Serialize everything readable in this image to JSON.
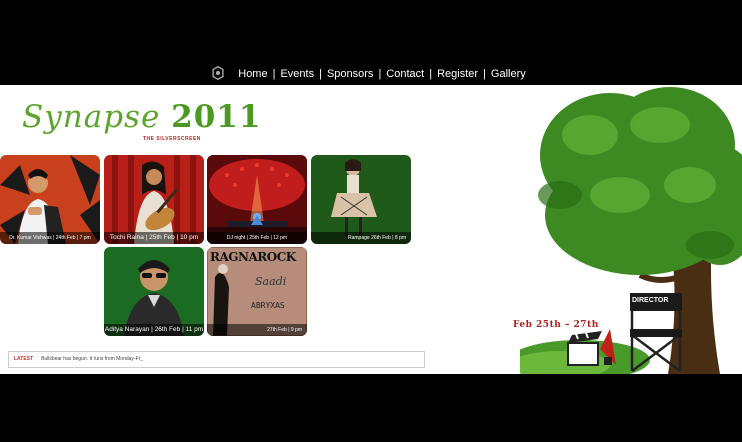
{
  "nav": {
    "items": [
      {
        "label": "Home"
      },
      {
        "label": "Events"
      },
      {
        "label": "Sponsors"
      },
      {
        "label": "Contact"
      },
      {
        "label": "Register"
      },
      {
        "label": "Gallery"
      }
    ],
    "separator": "|"
  },
  "header": {
    "logo_word": "Synapse",
    "logo_year": "2011",
    "tagline": "THE SILVERSCREEN"
  },
  "events": [
    {
      "caption": "Dr. Kumar Vishwas | 24th Feb | 7 pm"
    },
    {
      "caption": "Tochi Raina | 25th Feb | 10 pm"
    },
    {
      "caption": "DJ night | 25th Feb | 12 pm"
    },
    {
      "caption": "Rampage 26th Feb | 8 pm"
    },
    {
      "caption": "Aditya Narayan | 26th Feb | 11 pm"
    },
    {
      "caption": "27th Feb | 9 pm"
    }
  ],
  "poster_text": {
    "band": "RAGNAROCK",
    "word": "Saadi",
    "band2": "ABRYXAS"
  },
  "ticker": {
    "label": "LATEST",
    "message": "Bullsbear has begun. It runs from Monday-Fr_"
  },
  "festival_dates": "Feb 25th – 27th",
  "director_chair_label": "DIRECTOR",
  "colors": {
    "page_bg": "#000000",
    "content_bg": "#ffffff",
    "logo_green": "#5aa52a",
    "accent_red": "#a8231d"
  }
}
